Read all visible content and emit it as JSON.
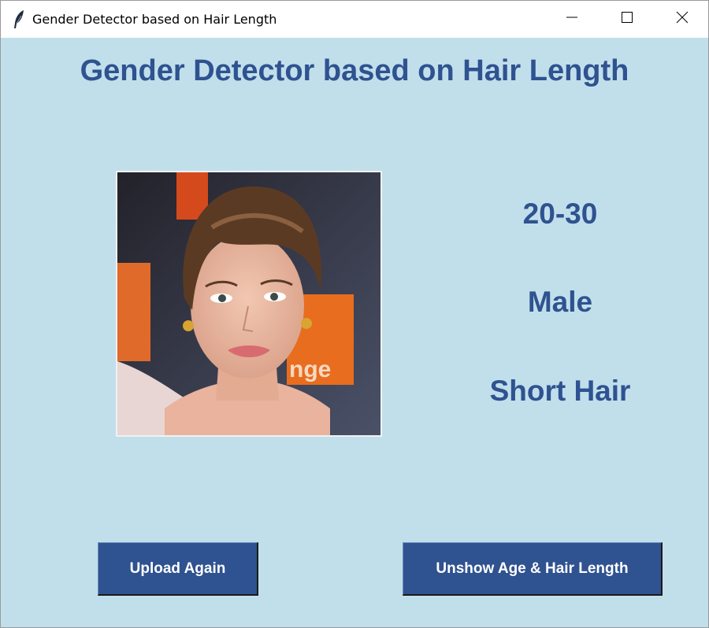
{
  "window": {
    "title": "Gender Detector based on Hair Length",
    "controls": [
      "minimize-icon",
      "maximize-icon",
      "close-icon"
    ],
    "app_icon": "feather-icon"
  },
  "main": {
    "heading": "Gender Detector based on Hair Length",
    "photo": "uploaded-face-photo",
    "results": {
      "age": "20-30",
      "gender": "Male",
      "hair": "Short Hair"
    },
    "buttons": {
      "upload_label": "Upload Again",
      "unshow_label": "Unshow Age & Hair Length"
    }
  },
  "colors": {
    "background": "#c1dfeb",
    "accent": "#2f5290",
    "button_text": "#ffffff"
  }
}
